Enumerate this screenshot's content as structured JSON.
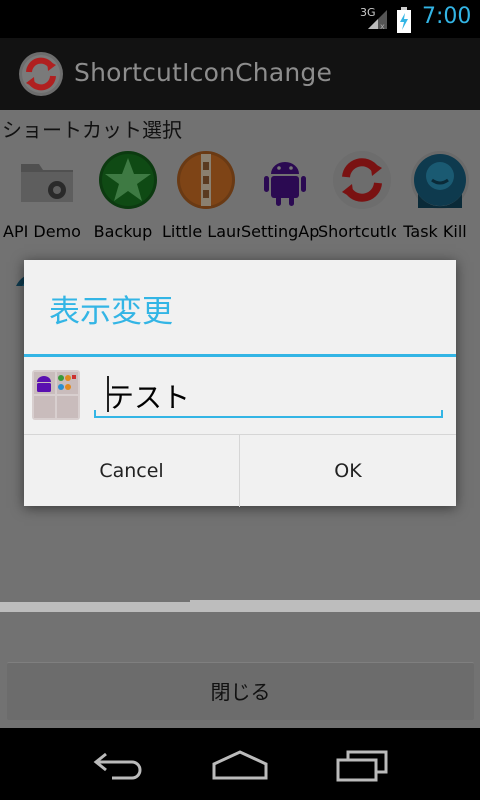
{
  "status_bar": {
    "network": "3G",
    "time": "7:00",
    "accent_color": "#33b5e5"
  },
  "action_bar": {
    "title": "ShortcutIconChange",
    "icon": "sync-refresh-icon"
  },
  "content": {
    "heading": "ショートカット選択",
    "apps_row1": [
      {
        "label": "API Demos",
        "icon": "folder-gear-icon"
      },
      {
        "label": "Backup",
        "icon": "green-star-icon"
      },
      {
        "label": "Little Launcher",
        "icon": "orange-zipper-icon"
      },
      {
        "label": "SettingApp",
        "icon": "android-robot-icon"
      },
      {
        "label": "ShortcutIconChange",
        "icon": "sync-refresh-icon"
      },
      {
        "label": "Task Kill",
        "icon": "task-kill-face-icon"
      }
    ],
    "close_button": "閉じる"
  },
  "dialog": {
    "title": "表示変更",
    "input_value": "テスト",
    "cancel_label": "Cancel",
    "ok_label": "OK"
  },
  "nav_bar": {
    "back": "back-icon",
    "home": "home-icon",
    "recents": "recents-icon"
  }
}
